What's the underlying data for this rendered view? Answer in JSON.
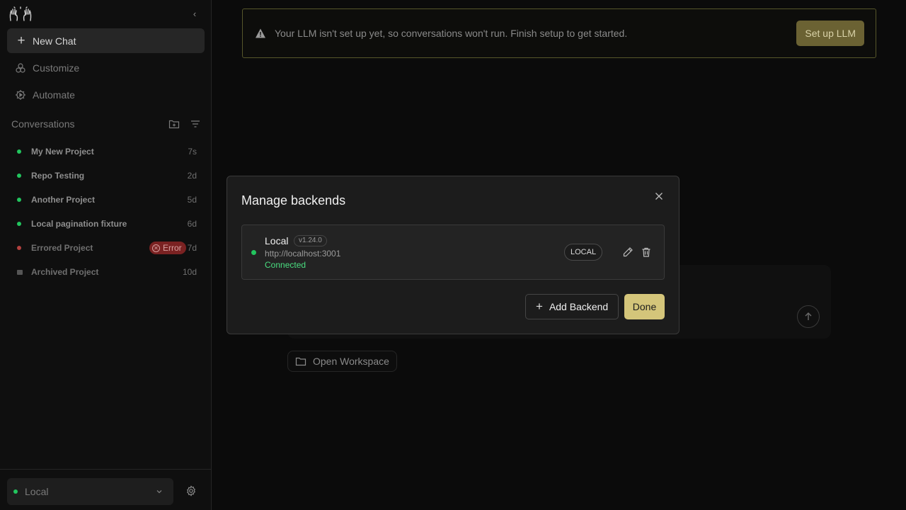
{
  "sidebar": {
    "new_chat": "New Chat",
    "nav": [
      {
        "label": "Customize",
        "icon": "customize-icon"
      },
      {
        "label": "Automate",
        "icon": "automate-icon"
      }
    ],
    "conversations_header": "Conversations",
    "conversations": [
      {
        "title": "My New Project",
        "time": "7s",
        "status": "active"
      },
      {
        "title": "Repo Testing",
        "time": "2d",
        "status": "active"
      },
      {
        "title": "Another Project",
        "time": "5d",
        "status": "active"
      },
      {
        "title": "Local pagination fixture",
        "time": "6d",
        "status": "active"
      },
      {
        "title": "Errored Project",
        "time": "7d",
        "status": "error",
        "badge": "Error"
      },
      {
        "title": "Archived Project",
        "time": "10d",
        "status": "archived"
      }
    ],
    "footer": {
      "backend": "Local"
    }
  },
  "banner": {
    "message": "Your LLM isn't set up yet, so conversations won't run. Finish setup to get started.",
    "button": "Set up LLM"
  },
  "main": {
    "open_workspace": "Open Workspace"
  },
  "modal": {
    "title": "Manage backends",
    "backends": [
      {
        "name": "Local",
        "version": "v1.24.0",
        "url": "http://localhost:3001",
        "status": "Connected",
        "type": "LOCAL"
      }
    ],
    "add_backend": "Add Backend",
    "done": "Done"
  },
  "colors": {
    "accent": "#d4c57a",
    "connected": "#22c55e",
    "error": "#7a2222",
    "status_text": "#4ade80"
  }
}
